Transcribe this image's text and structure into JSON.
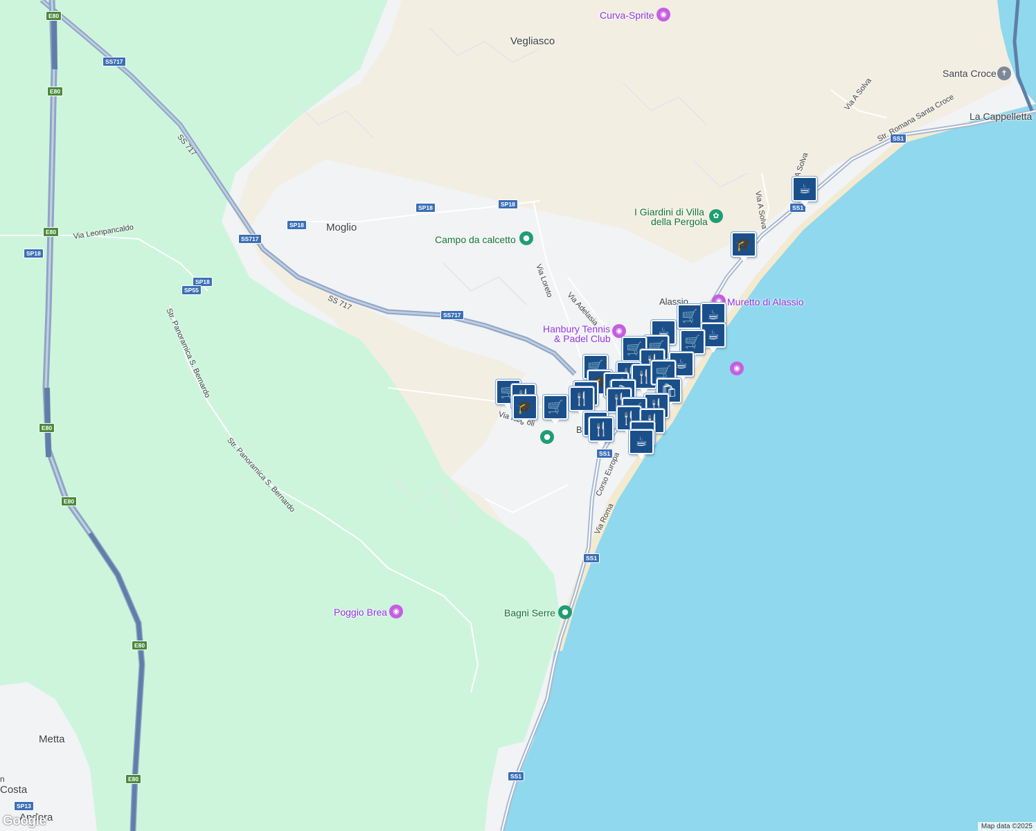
{
  "map": {
    "colors": {
      "sea": "#8fd8ed",
      "forest": "#cdf5dc",
      "urban": "#f1f3f4",
      "scrub": "#f3eee2",
      "sand": "#efe6d2",
      "motorway": "#8ea5c6",
      "tunnel": "#607ea8"
    },
    "towns": {
      "vegliasco": "Vegliasco",
      "moglio": "Moglio",
      "alassio": "Alassio",
      "santa_croce": "Santa Croce",
      "la_cappelletta": "La Cappelletta",
      "metta": "Metta",
      "andora": "Andora",
      "costa": "Costa",
      "costa_prefix": "n"
    },
    "pois": {
      "curva_sprite": "Curva-Sprite",
      "campo_calcetto": "Campo da calcetto",
      "giardini_line1": "I Giardini di Villa",
      "giardini_line2": "della Pergola",
      "muretto": "Muretto di Alassio",
      "hanbury_line1": "Hanbury Tennis",
      "hanbury_line2": "& Padel Club",
      "bagni_serre": "Bagni Serre",
      "poggio_brea": "Poggio Brea",
      "b_label": "B"
    },
    "streets": {
      "via_leonpancaldo": "Via Leonpancaldo",
      "panoramica_1": "Str. Panoramica S. Bernardo",
      "panoramica_2": "Str. Panoramica S. Bernardo",
      "ss717_text_1": "SS 717",
      "ss717_text_2": "SS 717",
      "via_loreto": "Via Loreto",
      "via_adelasia": "Via Adelasia",
      "via_negroli": "Via Negroli",
      "corso_europa": "Corso Europa",
      "via_roma": "Via Roma",
      "via_a_solva_1": "Via A Solva",
      "via_a_solva_2": "A Solva",
      "via_a_solva_3": "Via A Solva",
      "str_romana": "Str. Romana Santa Croce"
    },
    "shields": {
      "e80": "E80",
      "ss717": "SS717",
      "sp18": "SP18",
      "sp55": "SP55",
      "ss1": "SS1",
      "sp13": "SP13"
    },
    "icons": {
      "cart": "shopping-cart-icon",
      "cup": "coffee-icon",
      "fork": "restaurant-icon",
      "school": "school-icon",
      "camera": "camera-icon",
      "place": "place-icon",
      "bag": "shopping-bag-icon"
    },
    "attribution": "Map data ©2025",
    "logo": "Google"
  }
}
